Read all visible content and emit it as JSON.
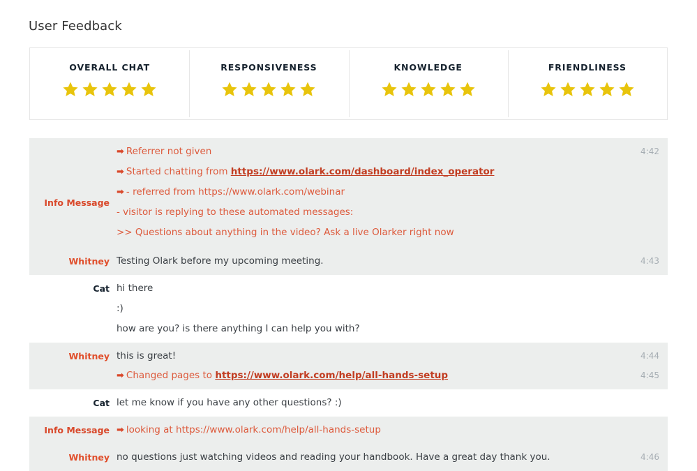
{
  "page": {
    "title": "User Feedback"
  },
  "ratings": {
    "max_stars": 5,
    "star_color": "#e8c40c",
    "cards": [
      {
        "label": "OVERALL CHAT",
        "stars": 5
      },
      {
        "label": "RESPONSIVENESS",
        "stars": 5
      },
      {
        "label": "KNOWLEDGE",
        "stars": 5
      },
      {
        "label": "FRIENDLINESS",
        "stars": 5
      }
    ]
  },
  "transcript": {
    "labels": {
      "info": "Info Message",
      "visitor": "Whitney",
      "operator": "Cat"
    },
    "rows": [
      {
        "name": "Info Message",
        "role": "info",
        "shaded": true,
        "time": "4:42",
        "lines": [
          {
            "arrow": true,
            "text": "Referrer not given"
          },
          {
            "arrow": true,
            "text": "Started chatting from ",
            "link": "https://www.olark.com/dashboard/index_operator"
          },
          {
            "arrow": true,
            "text": "- referred from https://www.olark.com/webinar"
          },
          {
            "arrow": false,
            "text": "- visitor is replying to these automated messages:"
          },
          {
            "arrow": false,
            "text": ">> Questions about anything in the video? Ask a live Olarker right now"
          }
        ]
      },
      {
        "name": "Whitney",
        "role": "visitor",
        "shaded": true,
        "time": "4:43",
        "lines": [
          {
            "arrow": false,
            "text": "Testing Olark before my upcoming meeting."
          }
        ]
      },
      {
        "name": "Cat",
        "role": "operator",
        "shaded": false,
        "time": "",
        "lines": [
          {
            "arrow": false,
            "text": "hi there"
          },
          {
            "arrow": false,
            "text": ":)"
          },
          {
            "arrow": false,
            "text": "how are you? is there anything I can help you with?"
          }
        ]
      },
      {
        "name": "Whitney",
        "role": "visitor",
        "shaded": true,
        "time": "4:44",
        "lines": [
          {
            "arrow": false,
            "text": "this is great!"
          }
        ],
        "extra": {
          "time": "4:45",
          "arrow": true,
          "text": "Changed pages to ",
          "link": "https://www.olark.com/help/all-hands-setup"
        }
      },
      {
        "name": "Cat",
        "role": "operator",
        "shaded": false,
        "time": "",
        "lines": [
          {
            "arrow": false,
            "text": "let me know if you have any other questions? :)"
          }
        ]
      },
      {
        "name": "Info Message",
        "role": "info",
        "shaded": true,
        "time": "",
        "lines": [
          {
            "arrow": true,
            "text": "looking at https://www.olark.com/help/all-hands-setup"
          }
        ]
      },
      {
        "name": "Whitney",
        "role": "visitor",
        "shaded": true,
        "time": "4:46",
        "lines": [
          {
            "arrow": false,
            "text": "no questions just watching videos and reading your handbook. Have a great day thank you."
          }
        ]
      }
    ]
  }
}
